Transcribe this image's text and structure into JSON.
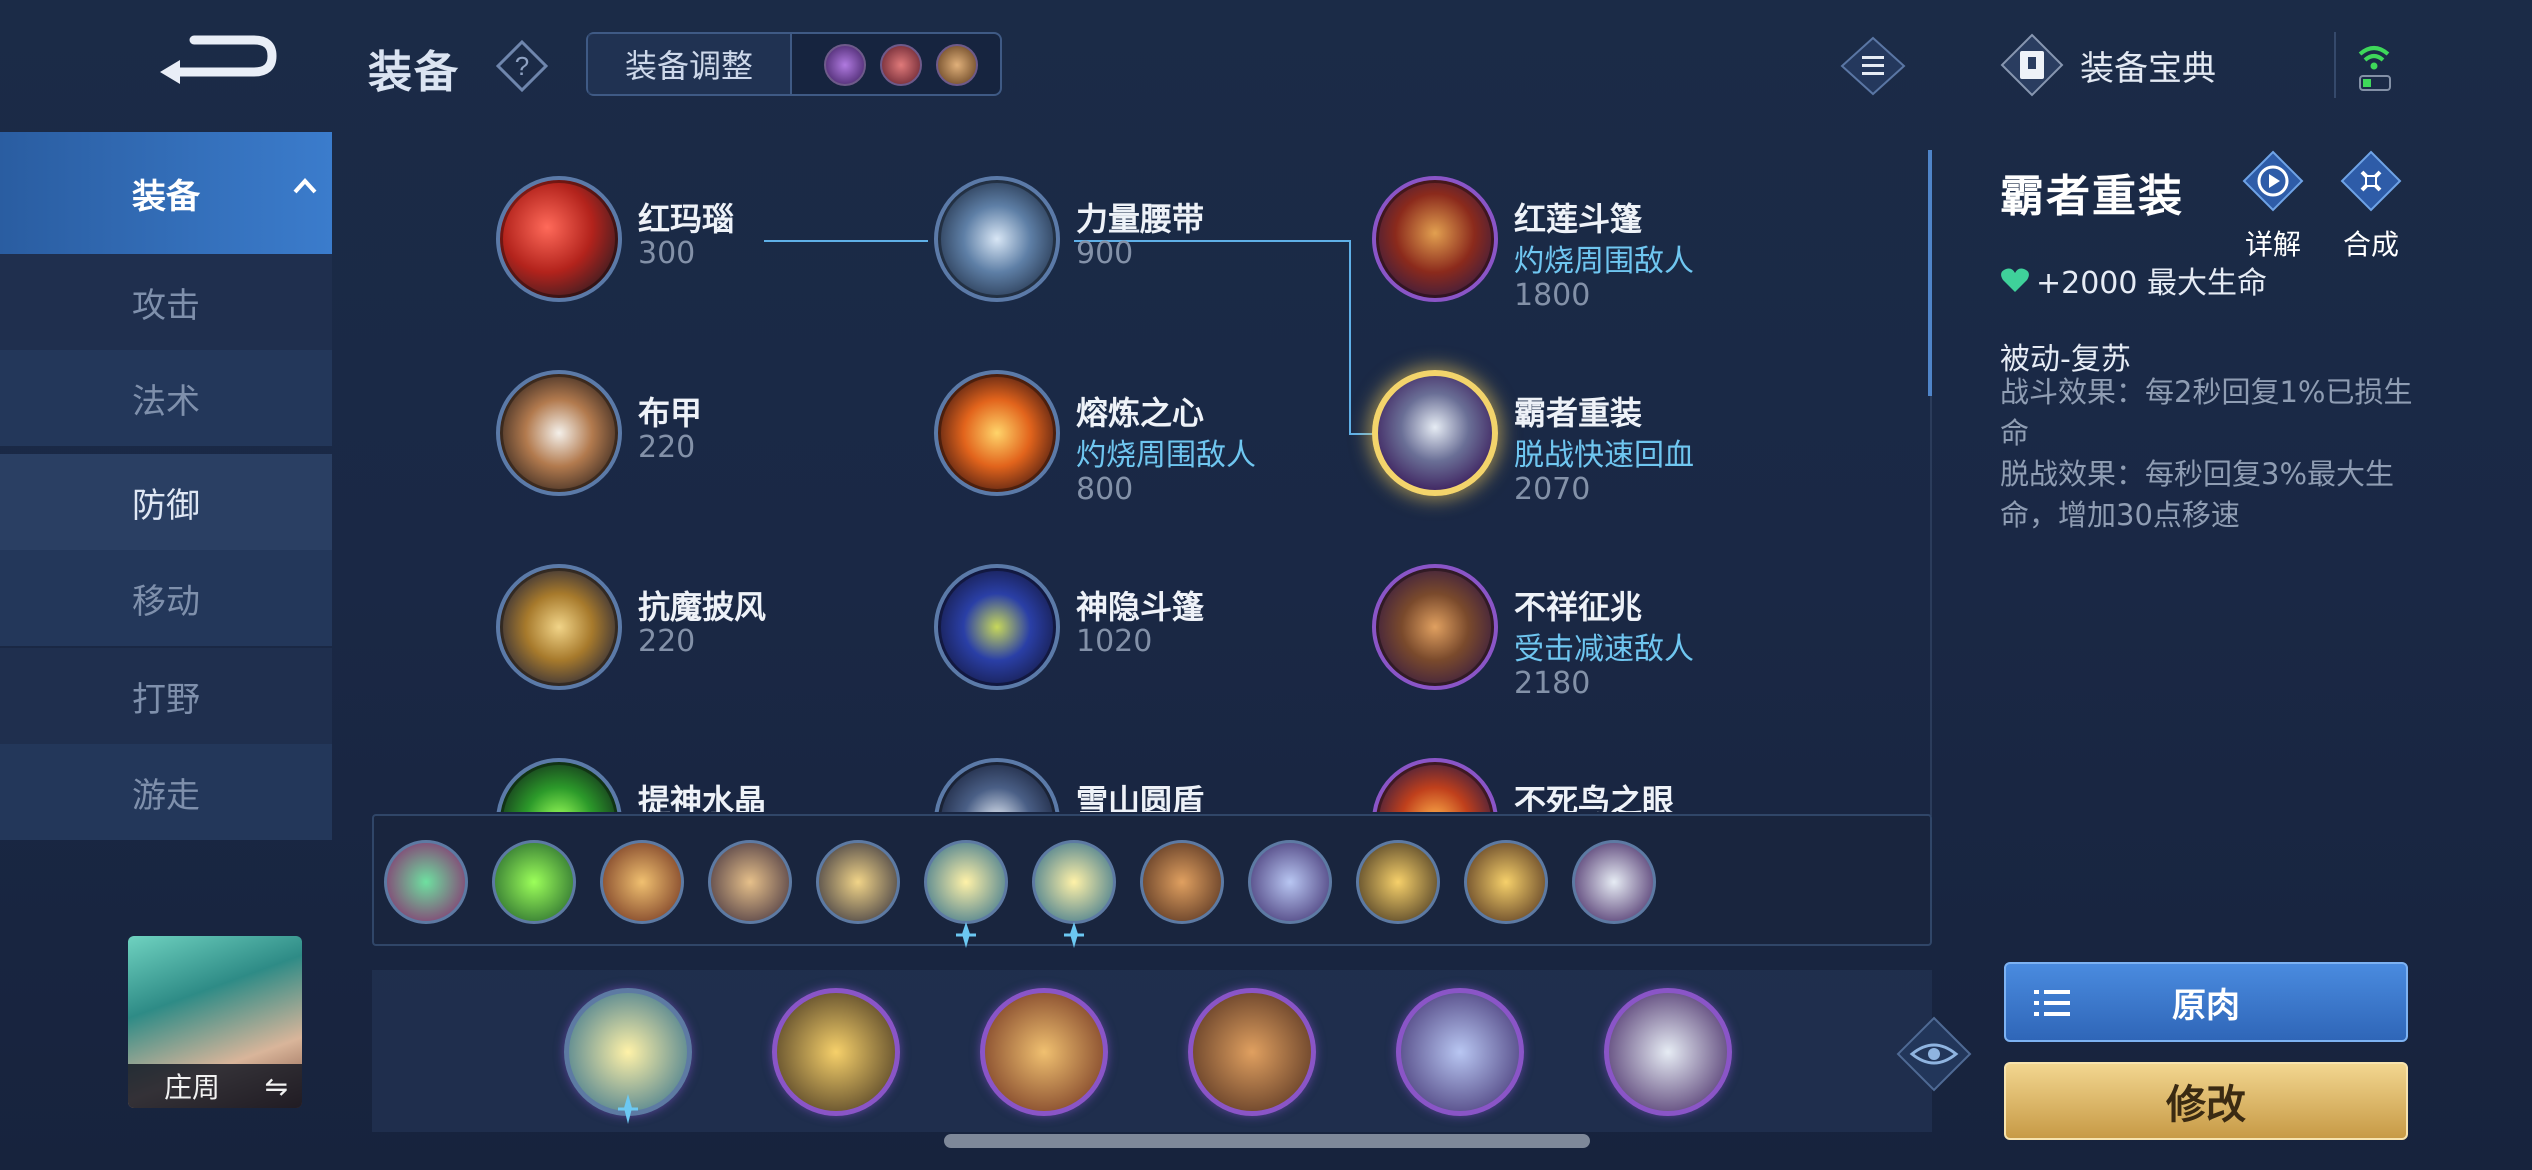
{
  "header": {
    "title": "装备",
    "adjust_label": "装备调整",
    "codex_label": "装备宝典"
  },
  "sidebar": {
    "items": [
      {
        "label": "装备",
        "state": "selected"
      },
      {
        "label": "攻击",
        "state": "normal"
      },
      {
        "label": "法术",
        "state": "normal"
      },
      {
        "label": "防御",
        "state": "current"
      },
      {
        "label": "移动",
        "state": "normal"
      },
      {
        "label": "打野",
        "state": "normal"
      },
      {
        "label": "游走",
        "state": "normal"
      }
    ]
  },
  "hero": {
    "name": "庄周",
    "swap_symbol": "⇋"
  },
  "items": [
    {
      "name": "红玛瑙",
      "effect": "",
      "price": "300"
    },
    {
      "name": "力量腰带",
      "effect": "",
      "price": "900"
    },
    {
      "name": "红莲斗篷",
      "effect": "灼烧周围敌人",
      "price": "1800"
    },
    {
      "name": "布甲",
      "effect": "",
      "price": "220"
    },
    {
      "name": "熔炼之心",
      "effect": "灼烧周围敌人",
      "price": "800"
    },
    {
      "name": "霸者重装",
      "effect": "脱战快速回血",
      "price": "2070",
      "selected": true
    },
    {
      "name": "抗魔披风",
      "effect": "",
      "price": "220"
    },
    {
      "name": "神隐斗篷",
      "effect": "",
      "price": "1020"
    },
    {
      "name": "不祥征兆",
      "effect": "受击减速敌人",
      "price": "2180"
    },
    {
      "name": "提神水晶",
      "effect": "",
      "price": ""
    },
    {
      "name": "雪山圆盾",
      "effect": "",
      "price": ""
    },
    {
      "name": "不死鸟之眼",
      "effect": "",
      "price": ""
    }
  ],
  "detail": {
    "title": "霸者重装",
    "detail_btn": "详解",
    "compose_btn": "合成",
    "stat": "+2000 最大生命",
    "passive_title": "被动-复苏",
    "passive_desc": "战斗效果：每2秒回复1%已损生命\n脱战效果：每秒回复3%最大生命，增加30点移速",
    "origin_btn": "原肉",
    "modify_btn": "修改"
  },
  "colors": {
    "accent_blue": "#3b7ccc",
    "effect_text": "#6fc6f0",
    "gold": "#f3d46b",
    "stat_heart": "#3fd19a"
  }
}
